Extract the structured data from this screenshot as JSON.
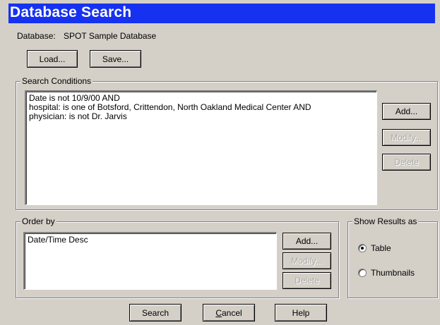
{
  "window": {
    "title": "Database Search"
  },
  "database": {
    "label": "Database:",
    "name": "SPOT Sample Database"
  },
  "file_buttons": {
    "load": "Load...",
    "save": "Save..."
  },
  "search_conditions": {
    "legend": "Search Conditions",
    "lines": [
      "Date is not 10/9/00  AND",
      "hospital: is one of Botsford, Crittendon, North Oakland Medical Center  AND",
      "physician: is not Dr. Jarvis"
    ],
    "add": "Add...",
    "modify": "Modify...",
    "delete": "Delete"
  },
  "order_by": {
    "legend": "Order by",
    "lines": [
      "Date/Time  Desc"
    ],
    "add": "Add...",
    "modify": "Modify...",
    "delete": "Delete"
  },
  "show_results": {
    "legend": "Show Results as",
    "options": [
      {
        "label": "Table",
        "selected": true
      },
      {
        "label": "Thumbnails",
        "selected": false
      }
    ]
  },
  "footer": {
    "search": "Search",
    "cancel_underlined": "C",
    "cancel_rest": "ancel",
    "help": "Help"
  }
}
